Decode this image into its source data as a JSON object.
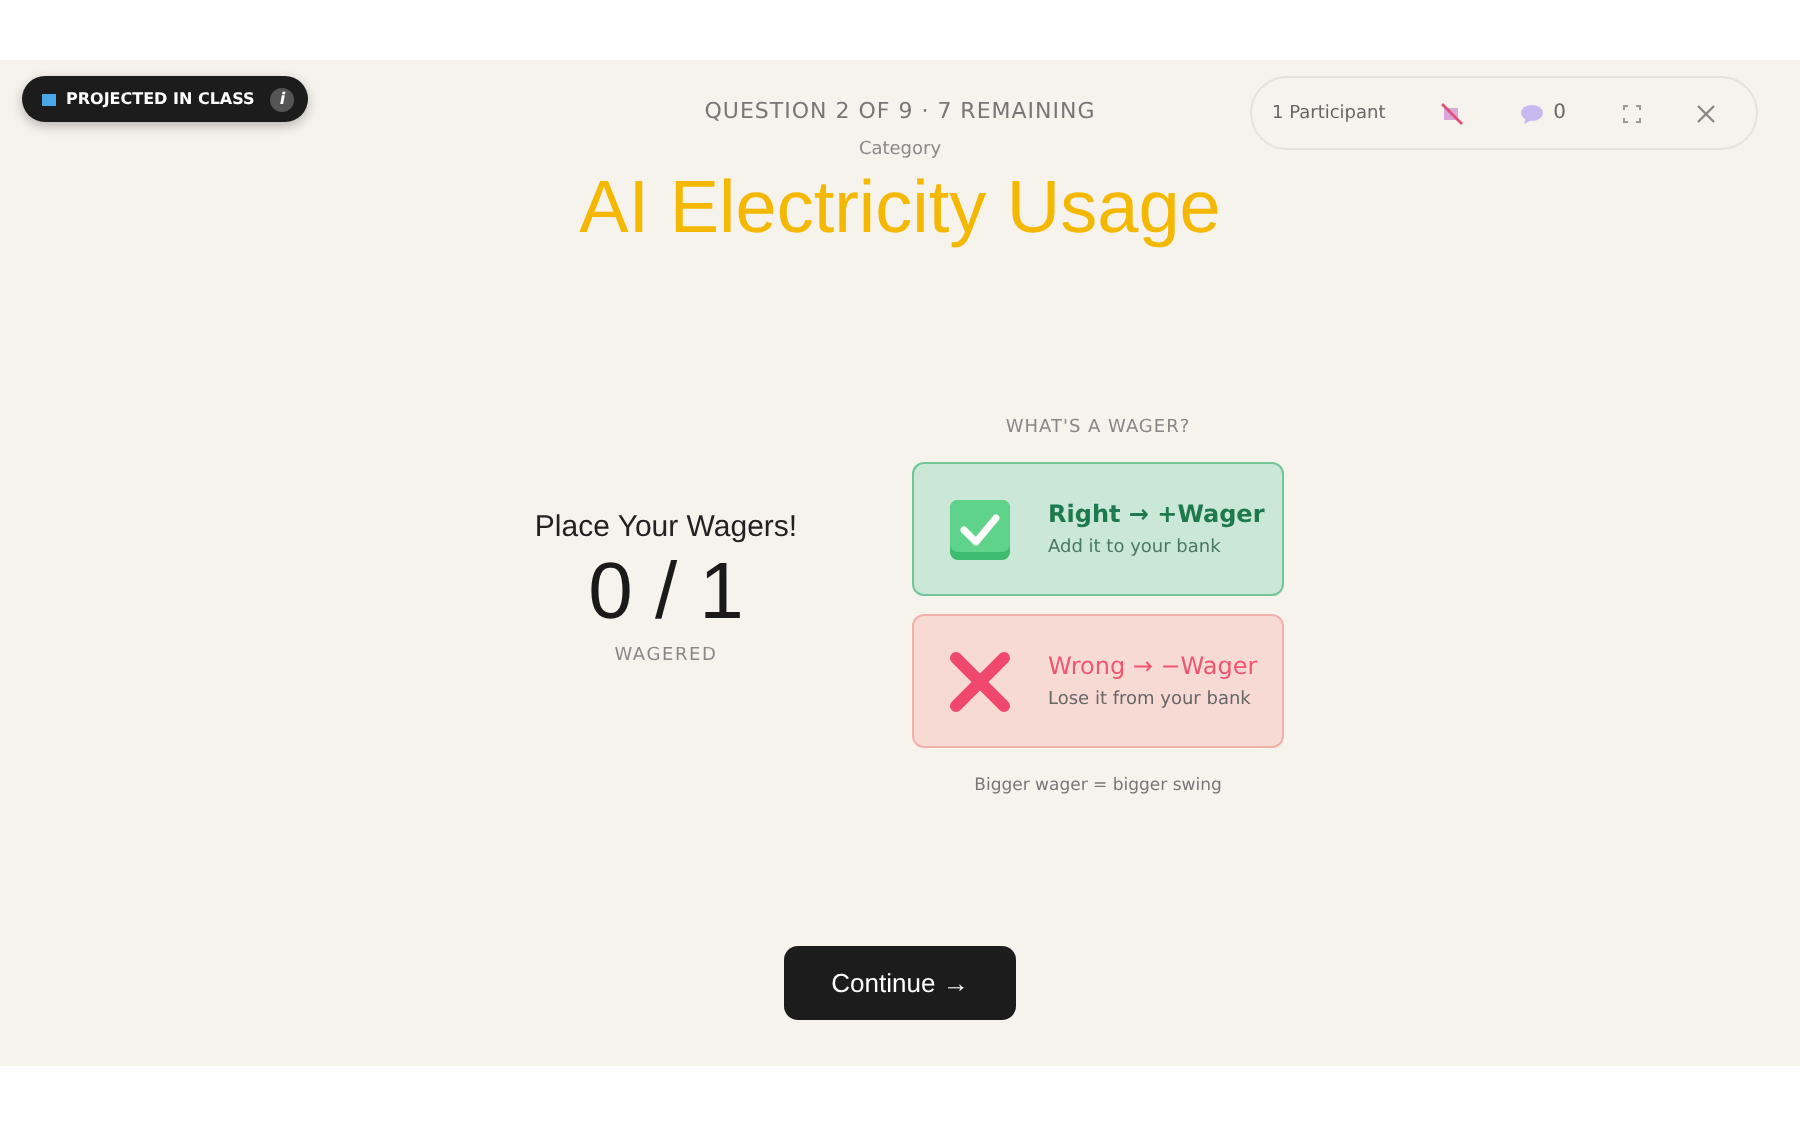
{
  "badge": {
    "label": "PROJECTED IN CLASS",
    "info": "i"
  },
  "header": {
    "progress": "QUESTION 2 OF 9 · 7 REMAINING",
    "category_label": "Category",
    "category": "AI Electricity Usage"
  },
  "session": {
    "participants": "1 Participant",
    "comments": "0"
  },
  "wagers": {
    "title": "Place Your Wagers!",
    "count": "0 / 1",
    "caption": "WAGERED"
  },
  "explainer": {
    "heading": "WHAT'S A WAGER?",
    "cards": [
      {
        "kind": "right",
        "title": "Right → +Wager",
        "text": "Add it to your bank"
      },
      {
        "kind": "wrong",
        "title": "Wrong → −Wager",
        "text": "Lose it from your bank"
      }
    ],
    "footnote": "Bigger wager = bigger swing"
  },
  "continue_button": "Continue →"
}
